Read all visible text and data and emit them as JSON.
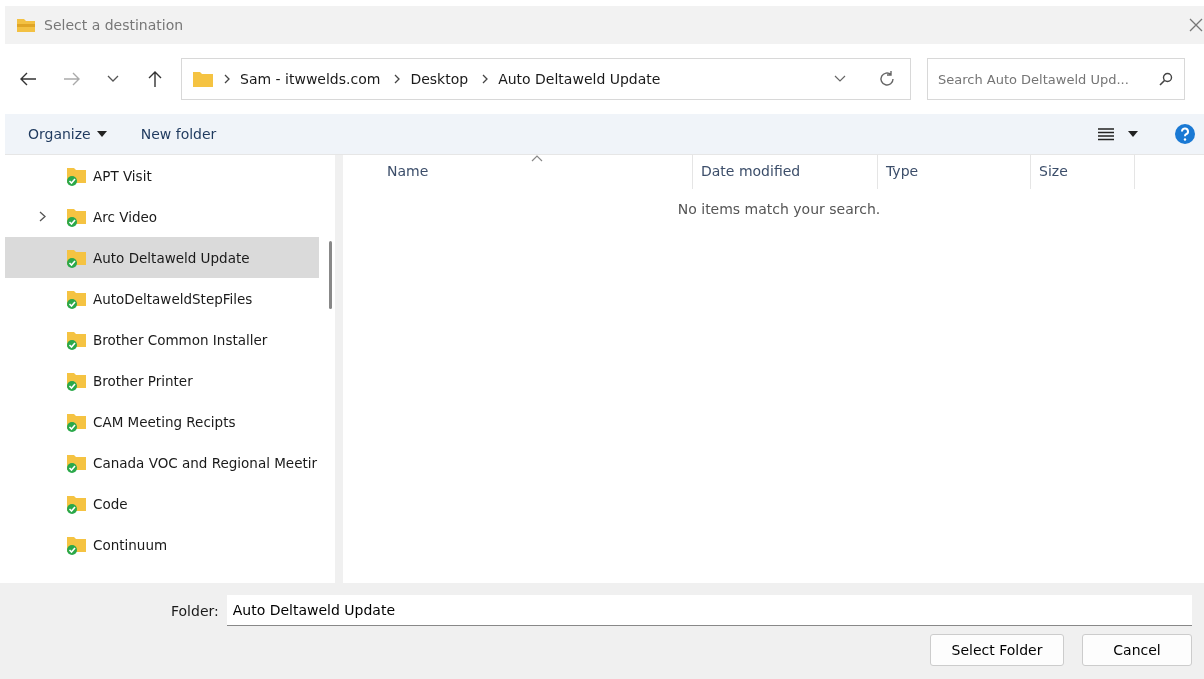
{
  "window": {
    "title": "Select a destination"
  },
  "breadcrumb": [
    "Sam - itwwelds.com",
    "Desktop",
    "Auto Deltaweld Update"
  ],
  "search": {
    "placeholder": "Search Auto Deltaweld Upd..."
  },
  "toolbar": {
    "organize": "Organize",
    "new_folder": "New folder"
  },
  "sidebar": {
    "items": [
      {
        "label": "APT Visit",
        "expandable": false,
        "selected": false
      },
      {
        "label": "Arc Video",
        "expandable": true,
        "selected": false
      },
      {
        "label": "Auto Deltaweld Update",
        "expandable": false,
        "selected": true
      },
      {
        "label": "AutoDeltaweldStepFiles",
        "expandable": false,
        "selected": false
      },
      {
        "label": "Brother Common Installer",
        "expandable": false,
        "selected": false
      },
      {
        "label": "Brother Printer",
        "expandable": false,
        "selected": false
      },
      {
        "label": "CAM Meeting Recipts",
        "expandable": false,
        "selected": false
      },
      {
        "label": "Canada VOC and Regional Meetir",
        "expandable": false,
        "selected": false
      },
      {
        "label": "Code",
        "expandable": false,
        "selected": false
      },
      {
        "label": "Continuum",
        "expandable": false,
        "selected": false
      }
    ]
  },
  "table": {
    "columns": [
      "Name",
      "Date modified",
      "Type",
      "Size"
    ],
    "empty_message": "No items match your search."
  },
  "folder_field": {
    "label": "Folder:",
    "value": "Auto Deltaweld Update"
  },
  "buttons": [
    "Select Folder",
    "Cancel"
  ]
}
